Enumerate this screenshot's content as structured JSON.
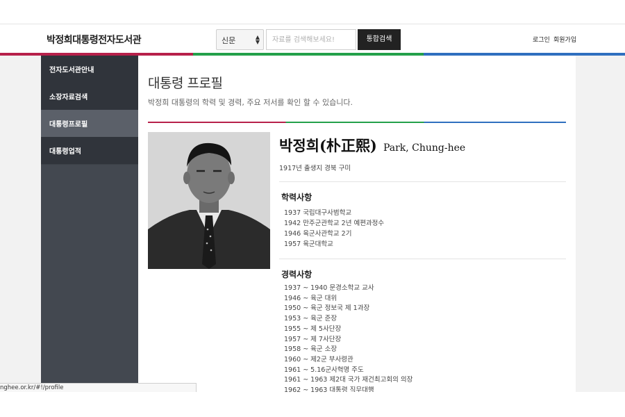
{
  "header": {
    "site_title": "박정희대통령전자도서관",
    "search_select_value": "신문",
    "search_placeholder": "자료를 검색해보세요!",
    "search_button": "통합검색",
    "login": "로그인",
    "signup": "회원가입"
  },
  "colors": {
    "bar_red": "#b7204a",
    "bar_green": "#23a04a",
    "bar_blue": "#2f6fbf",
    "sidebar_bg": "#434850",
    "sidebar_item_bg": "#30343b",
    "sidebar_active_bg": "#5b6069"
  },
  "sidebar": {
    "items": [
      {
        "label": "전자도서관안내"
      },
      {
        "label": "소장자료검색"
      },
      {
        "label": "대통령프로필"
      },
      {
        "label": "대통령업적"
      }
    ]
  },
  "main": {
    "title": "대통령 프로필",
    "subtitle": "박정희 대통령의 학력 및 경력, 주요 저서를 확인 할 수 있습니다.",
    "profile": {
      "name_ko": "박정희(朴正熙)",
      "name_en": "Park, Chung-hee",
      "birth": "1917년 출생지 경북 구미"
    },
    "education": {
      "title": "학력사항",
      "items": [
        "1937 국립대구사범학교",
        "1942 만주군관학교 2년 예편과정수",
        "1946 육군사관학교 2기",
        "1957 육군대학교"
      ]
    },
    "career": {
      "title": "경력사항",
      "items": [
        "1937 ~ 1940 문경소학교 교사",
        "1946 ~ 육군 대위",
        "1950 ~ 육군 정보국 제 1과장",
        "1953 ~ 육군 준장",
        "1955 ~ 제 5사단장",
        "1957 ~ 제 7사단장",
        "1958 ~ 육군 소장",
        "1960 ~ 제2군 부사령관",
        "1961 ~ 5.16군사혁명 주도",
        "1961 ~ 1963 제2대 국가 재건최고회의 의장",
        "1962 ~ 1963 대통령 직무대행"
      ]
    }
  },
  "status_bar": {
    "url": "nghee.or.kr/#!/profile"
  }
}
